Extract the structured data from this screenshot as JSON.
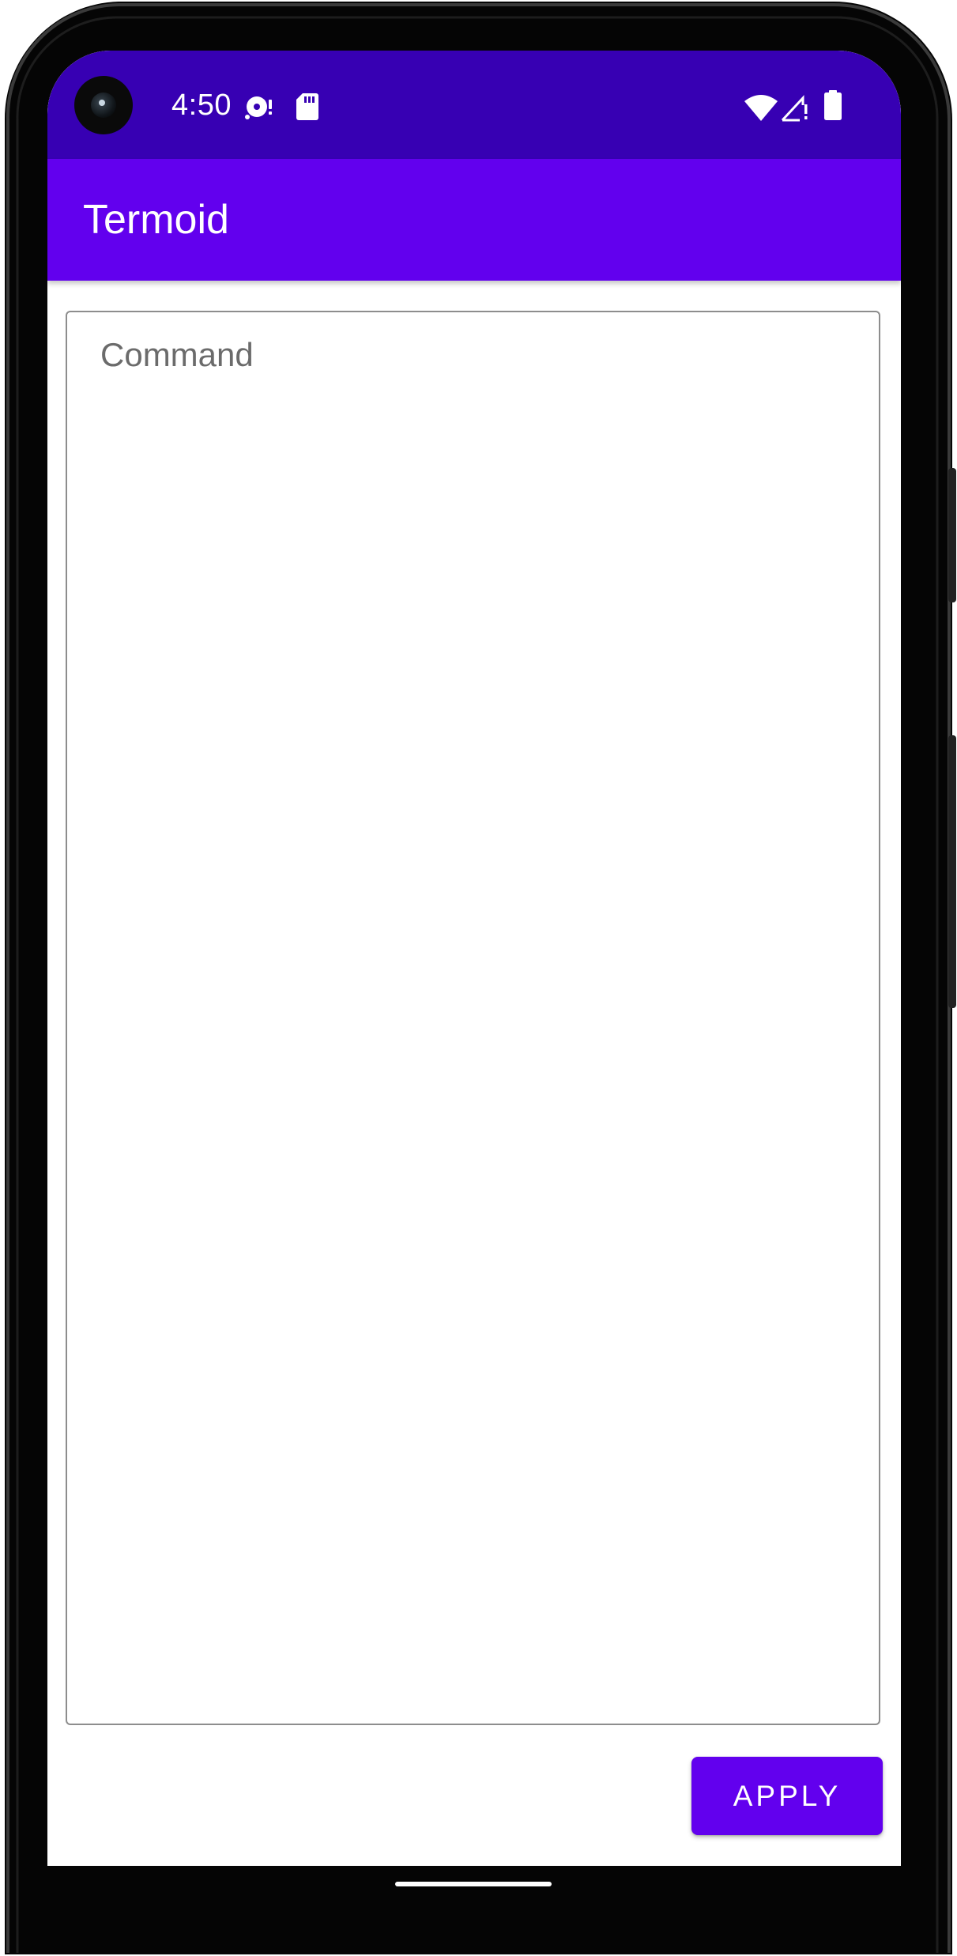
{
  "status_bar": {
    "time": "4:50",
    "icons": [
      "media-sync-icon",
      "sd-card-icon",
      "wifi-icon",
      "cellular-signal-icon",
      "battery-icon"
    ],
    "background": "#3700b3"
  },
  "app_bar": {
    "title": "Termoid",
    "background": "#6200ee"
  },
  "command_field": {
    "placeholder": "Command",
    "value": ""
  },
  "apply_button": {
    "label": "APPLY",
    "background": "#6200ee"
  }
}
